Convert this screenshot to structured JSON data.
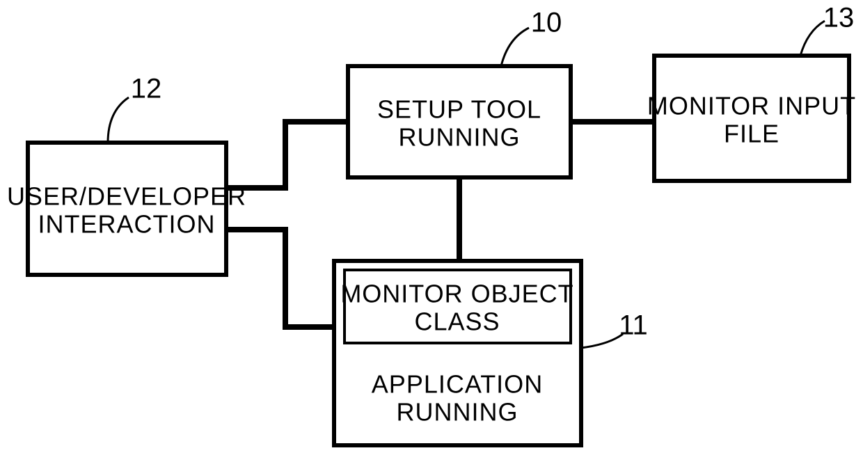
{
  "diagram": {
    "boxes": {
      "user_dev": {
        "ref": "12",
        "line1": "USER/DEVELOPER",
        "line2": "INTERACTION"
      },
      "setup_tool": {
        "ref": "10",
        "line1": "SETUP TOOL",
        "line2": "RUNNING"
      },
      "monitor_input": {
        "ref": "13",
        "line1": "MONITOR INPUT",
        "line2": "FILE"
      },
      "application": {
        "ref": "11",
        "inner_line1": "MONITOR OBJECT",
        "inner_line2": "CLASS",
        "line1": "APPLICATION",
        "line2": "RUNNING"
      }
    }
  }
}
